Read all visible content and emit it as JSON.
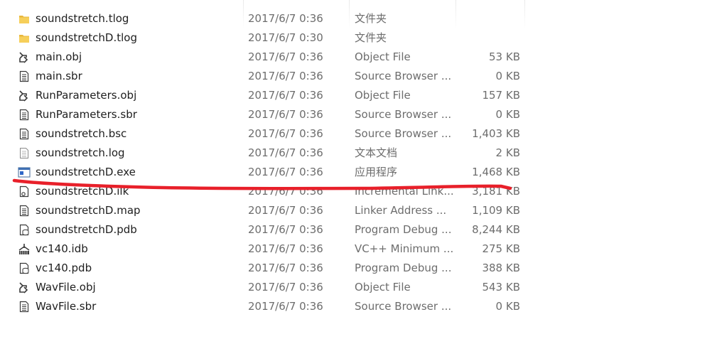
{
  "files": [
    {
      "name": "soundstretch.tlog",
      "date": "2017/6/7 0:36",
      "type": "文件夹",
      "size": "",
      "icon": "folder-icon"
    },
    {
      "name": "soundstretchD.tlog",
      "date": "2017/6/7 0:30",
      "type": "文件夹",
      "size": "",
      "icon": "folder-icon"
    },
    {
      "name": "main.obj",
      "date": "2017/6/7 0:36",
      "type": "Object File",
      "size": "53 KB",
      "icon": "object-file-icon"
    },
    {
      "name": "main.sbr",
      "date": "2017/6/7 0:36",
      "type": "Source Browser ...",
      "size": "0 KB",
      "icon": "document-icon"
    },
    {
      "name": "RunParameters.obj",
      "date": "2017/6/7 0:36",
      "type": "Object File",
      "size": "157 KB",
      "icon": "object-file-icon"
    },
    {
      "name": "RunParameters.sbr",
      "date": "2017/6/7 0:36",
      "type": "Source Browser ...",
      "size": "0 KB",
      "icon": "document-icon"
    },
    {
      "name": "soundstretch.bsc",
      "date": "2017/6/7 0:36",
      "type": "Source Browser ...",
      "size": "1,403 KB",
      "icon": "document-icon"
    },
    {
      "name": "soundstretch.log",
      "date": "2017/6/7 0:36",
      "type": "文本文档",
      "size": "2 KB",
      "icon": "text-file-icon"
    },
    {
      "name": "soundstretchD.exe",
      "date": "2017/6/7 0:36",
      "type": "应用程序",
      "size": "1,468 KB",
      "icon": "application-icon"
    },
    {
      "name": "soundstretchD.ilk",
      "date": "2017/6/7 0:36",
      "type": "Incremental Link...",
      "size": "3,181 KB",
      "icon": "link-file-icon"
    },
    {
      "name": "soundstretchD.map",
      "date": "2017/6/7 0:36",
      "type": "Linker Address ...",
      "size": "1,109 KB",
      "icon": "document-icon"
    },
    {
      "name": "soundstretchD.pdb",
      "date": "2017/6/7 0:36",
      "type": "Program Debug ...",
      "size": "8,244 KB",
      "icon": "debug-database-icon"
    },
    {
      "name": "vc140.idb",
      "date": "2017/6/7 0:36",
      "type": "VC++ Minimum ...",
      "size": "275 KB",
      "icon": "idb-file-icon"
    },
    {
      "name": "vc140.pdb",
      "date": "2017/6/7 0:36",
      "type": "Program Debug ...",
      "size": "388 KB",
      "icon": "debug-database-icon"
    },
    {
      "name": "WavFile.obj",
      "date": "2017/6/7 0:36",
      "type": "Object File",
      "size": "543 KB",
      "icon": "object-file-icon"
    },
    {
      "name": "WavFile.sbr",
      "date": "2017/6/7 0:36",
      "type": "Source Browser ...",
      "size": "0 KB",
      "icon": "document-icon"
    }
  ],
  "annotation": {
    "color": "#e8202a",
    "marks": "soundstretchD.exe"
  }
}
